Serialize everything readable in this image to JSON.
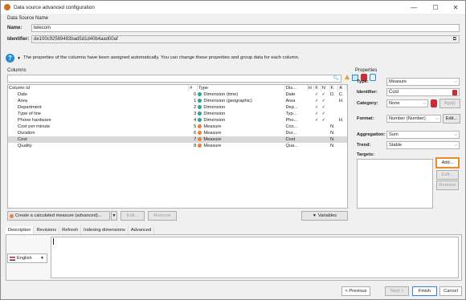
{
  "window": {
    "title": "Data source advanced configuration",
    "minimize": "—",
    "maximize": "☐",
    "close": "✕"
  },
  "datasource": {
    "section_label": "Data Source Name",
    "name_label": "Name:",
    "name_value": "telecom",
    "identifier_label": "Identifier:",
    "identifier_value": "de100c92569483bad5d1d40b4aad00af"
  },
  "info": {
    "text": "The properties of the columns have been assigned automatically. You can change these properties and group data for each column."
  },
  "columns": {
    "section_label": "Columns",
    "headers": [
      "Column Id",
      "#",
      "Type",
      "Dis...",
      "H",
      "F.",
      "N",
      "F.",
      "A"
    ],
    "rows": [
      {
        "name": "Date",
        "num": "0",
        "type": "Dimension (time)",
        "kind": "dim",
        "dis": "Date",
        "h": "",
        "f1": "✓",
        "n": "✓",
        "f2": "D.",
        "a": "C."
      },
      {
        "name": "Area",
        "num": "1",
        "type": "Dimension (geographic)",
        "kind": "dim",
        "dis": "Area",
        "h": "",
        "f1": "✓",
        "n": "✓",
        "f2": "",
        "a": "H."
      },
      {
        "name": "Department",
        "num": "2",
        "type": "Dimension",
        "kind": "dim",
        "dis": "Dep...",
        "h": "",
        "f1": "✓",
        "n": "✓",
        "f2": "",
        "a": ""
      },
      {
        "name": "Type of line",
        "num": "3",
        "type": "Dimension",
        "kind": "dim",
        "dis": "Typ...",
        "h": "",
        "f1": "✓",
        "n": "✓",
        "f2": "",
        "a": ""
      },
      {
        "name": "Phone hardware",
        "num": "4",
        "type": "Dimension",
        "kind": "dim",
        "dis": "Pho...",
        "h": "",
        "f1": "✓",
        "n": "✓",
        "f2": "",
        "a": "H."
      },
      {
        "name": "Cost per minute",
        "num": "5",
        "type": "Measure",
        "kind": "mea",
        "dis": "Cos...",
        "h": "",
        "f1": "",
        "n": "",
        "f2": "N.",
        "a": ""
      },
      {
        "name": "Duration",
        "num": "6",
        "type": "Measure",
        "kind": "mea",
        "dis": "Dur...",
        "h": "",
        "f1": "",
        "n": "",
        "f2": "N.",
        "a": ""
      },
      {
        "name": "Cost",
        "num": "7",
        "type": "Measure",
        "kind": "mea",
        "dis": "Cost",
        "h": "",
        "f1": "",
        "n": "",
        "f2": "N.",
        "a": ""
      },
      {
        "name": "Quality",
        "num": "8",
        "type": "Measure",
        "kind": "mea",
        "dis": "Qua...",
        "h": "",
        "f1": "",
        "n": "",
        "f2": "N.",
        "a": ""
      }
    ],
    "selected_row": 7,
    "create_measure": "Create a calculated measure (advanced)...",
    "edit": "Edit...",
    "remove": "Remove",
    "variables": "Variables"
  },
  "properties": {
    "section_label": "Properties",
    "type_label": "Type:",
    "type_value": "Measure",
    "identifier_label": "Identifier:",
    "identifier_value": "Cost",
    "category_label": "Category:",
    "category_value": "None",
    "apply": "Apply",
    "format_label": "Format:",
    "format_value": "Number (Number)",
    "format_edit": "Edit...",
    "aggregation_label": "Aggregation:",
    "aggregation_value": "Sum",
    "trend_label": "Trend:",
    "trend_value": "Stable",
    "targets_label": "Targets:",
    "add": "Add...",
    "edit": "Edit...",
    "remove": "Remove"
  },
  "bottom_tabs": [
    "Description",
    "Revisions",
    "Refresh",
    "Indexing dimensions",
    "Advanced"
  ],
  "language": "English",
  "footer": {
    "previous": "< Previous",
    "next": "Next >",
    "finish": "Finish",
    "cancel": "Cancel"
  },
  "colors": {
    "dimension": "#2aa39a",
    "measure": "#e8823a",
    "accent": "#e58e2e",
    "info": "#1e8fd5"
  }
}
